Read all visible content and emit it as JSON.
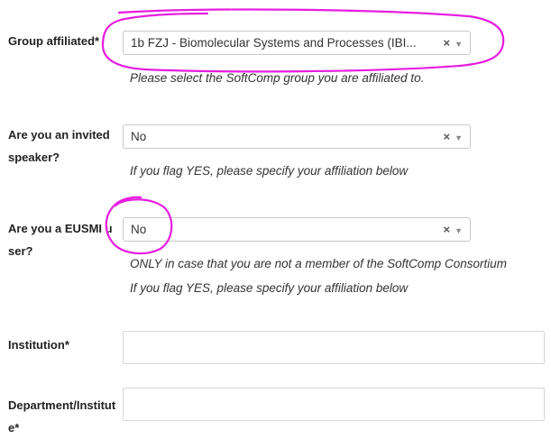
{
  "group": {
    "label": "Group affiliated*",
    "value": "1b FZJ - Biomolecular Systems and Processes (IBI...",
    "clear": "×",
    "arrow": "▼",
    "hint": "Please select the SoftComp group you are affiliated to."
  },
  "invited": {
    "label": "Are you an invited speaker?",
    "value": "No",
    "clear": "×",
    "arrow": "▼",
    "hint": "If you flag YES, please specify your affiliation below"
  },
  "eusmi": {
    "label": "Are you a EUSMI user?",
    "value": "No",
    "clear": "×",
    "arrow": "▼",
    "hint_1": "ONLY in case that you are not a member of the SoftComp Consortium",
    "hint_2": "If you flag YES, please specify your affiliation below"
  },
  "institution": {
    "label": "Institution*",
    "value": ""
  },
  "department": {
    "label": "Department/Institute*",
    "value": ""
  },
  "annotation_color": "#e61de0"
}
